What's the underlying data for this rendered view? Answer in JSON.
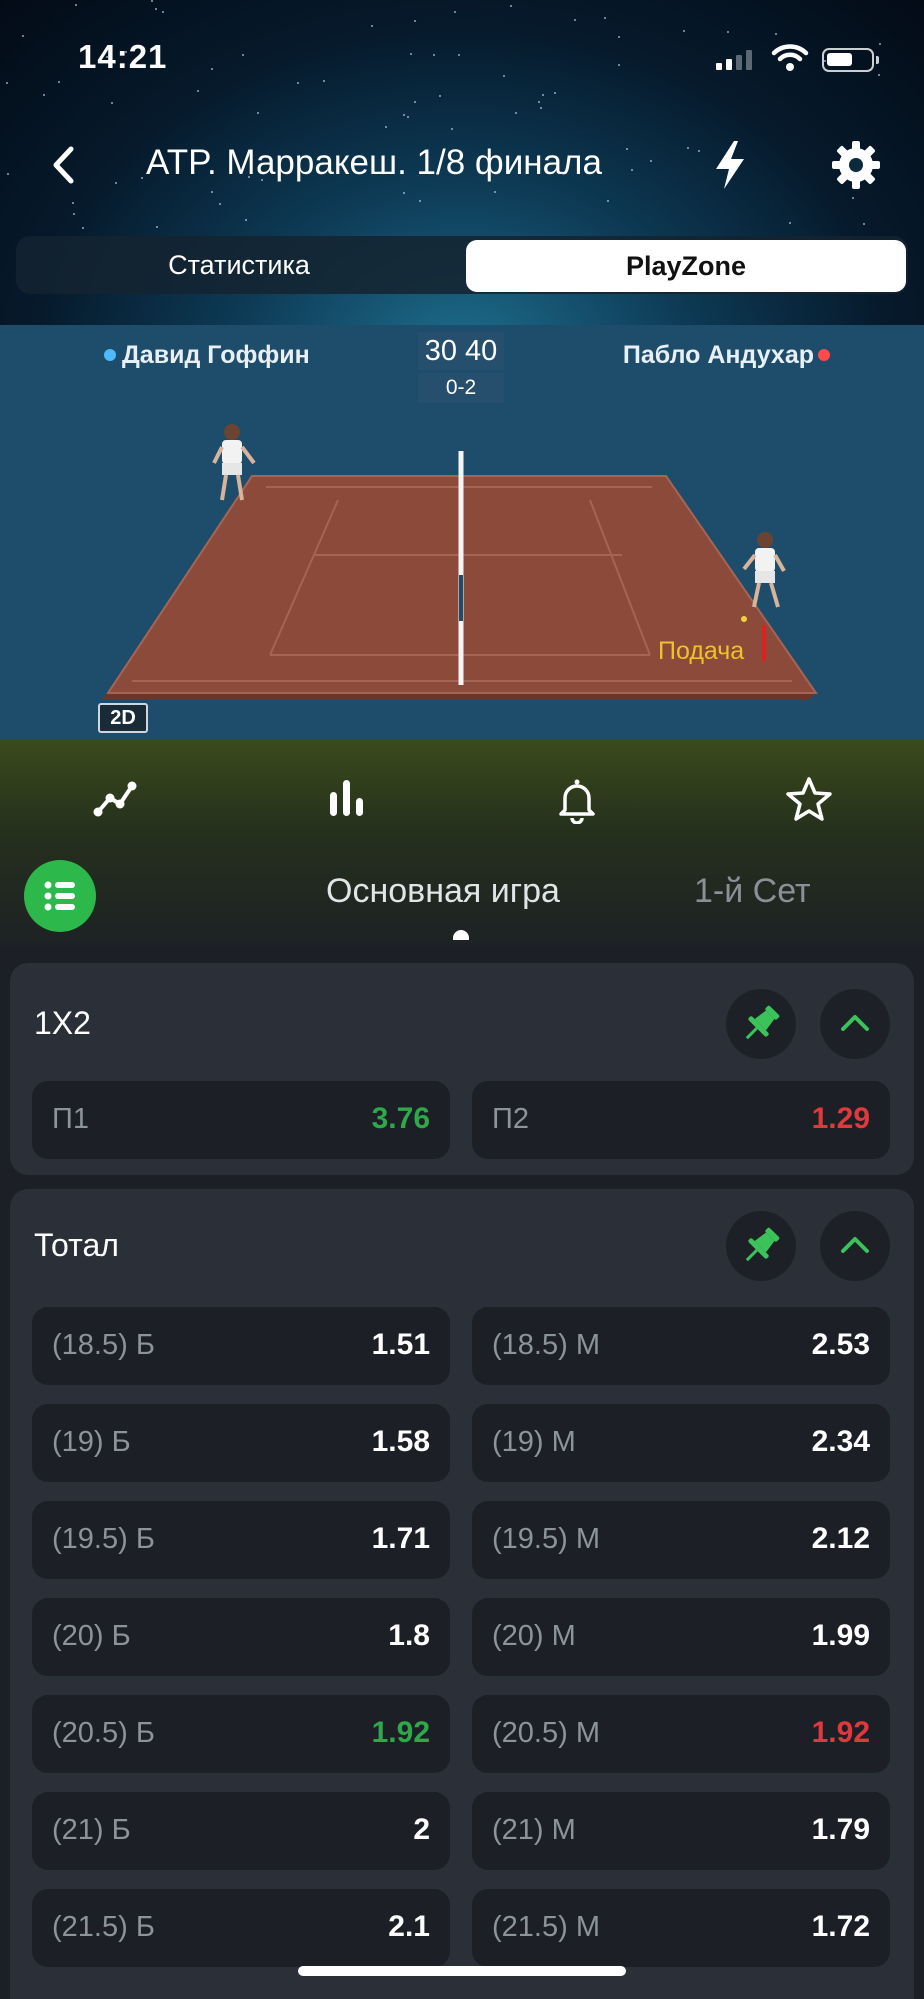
{
  "status_bar": {
    "time": "14:21"
  },
  "nav": {
    "title": "ATP. Марракеш. 1/8 финала"
  },
  "segment_tabs": [
    {
      "label": "Статистика"
    },
    {
      "label": "PlayZone"
    }
  ],
  "match": {
    "player1": "Давид Гоффин",
    "player2": "Пабло Андухар",
    "score": "30 40",
    "games": "0-2",
    "serve_label": "Подача",
    "view_mode": "2D"
  },
  "icons": {
    "toolbar": [
      "chart-line-icon",
      "bars-icon",
      "bell-icon",
      "star-icon"
    ],
    "list": "list-icon"
  },
  "sub_tabs": [
    {
      "label": "Основная игра"
    },
    {
      "label": "1-й Сет"
    }
  ],
  "markets": {
    "x12": {
      "title": "1X2",
      "cells": [
        {
          "label": "П1",
          "value": "3.76",
          "trend": "up"
        },
        {
          "label": "П2",
          "value": "1.29",
          "trend": "down"
        }
      ]
    },
    "total": {
      "title": "Тотал",
      "rows": [
        [
          {
            "label": "(18.5) Б",
            "value": "1.51"
          },
          {
            "label": "(18.5) М",
            "value": "2.53"
          }
        ],
        [
          {
            "label": "(19) Б",
            "value": "1.58"
          },
          {
            "label": "(19) М",
            "value": "2.34"
          }
        ],
        [
          {
            "label": "(19.5) Б",
            "value": "1.71"
          },
          {
            "label": "(19.5) М",
            "value": "2.12"
          }
        ],
        [
          {
            "label": "(20) Б",
            "value": "1.8"
          },
          {
            "label": "(20) М",
            "value": "1.99"
          }
        ],
        [
          {
            "label": "(20.5) Б",
            "value": "1.92",
            "trend": "up"
          },
          {
            "label": "(20.5) М",
            "value": "1.92",
            "trend": "down"
          }
        ],
        [
          {
            "label": "(21) Б",
            "value": "2"
          },
          {
            "label": "(21) М",
            "value": "1.79"
          }
        ],
        [
          {
            "label": "(21.5) Б",
            "value": "2.1"
          },
          {
            "label": "(21.5) М",
            "value": "1.72"
          }
        ]
      ]
    }
  },
  "colors": {
    "accent_green": "#2db84b",
    "odds_up": "#2fa84a",
    "odds_down": "#e0393b",
    "court": "#8b4a3a"
  }
}
